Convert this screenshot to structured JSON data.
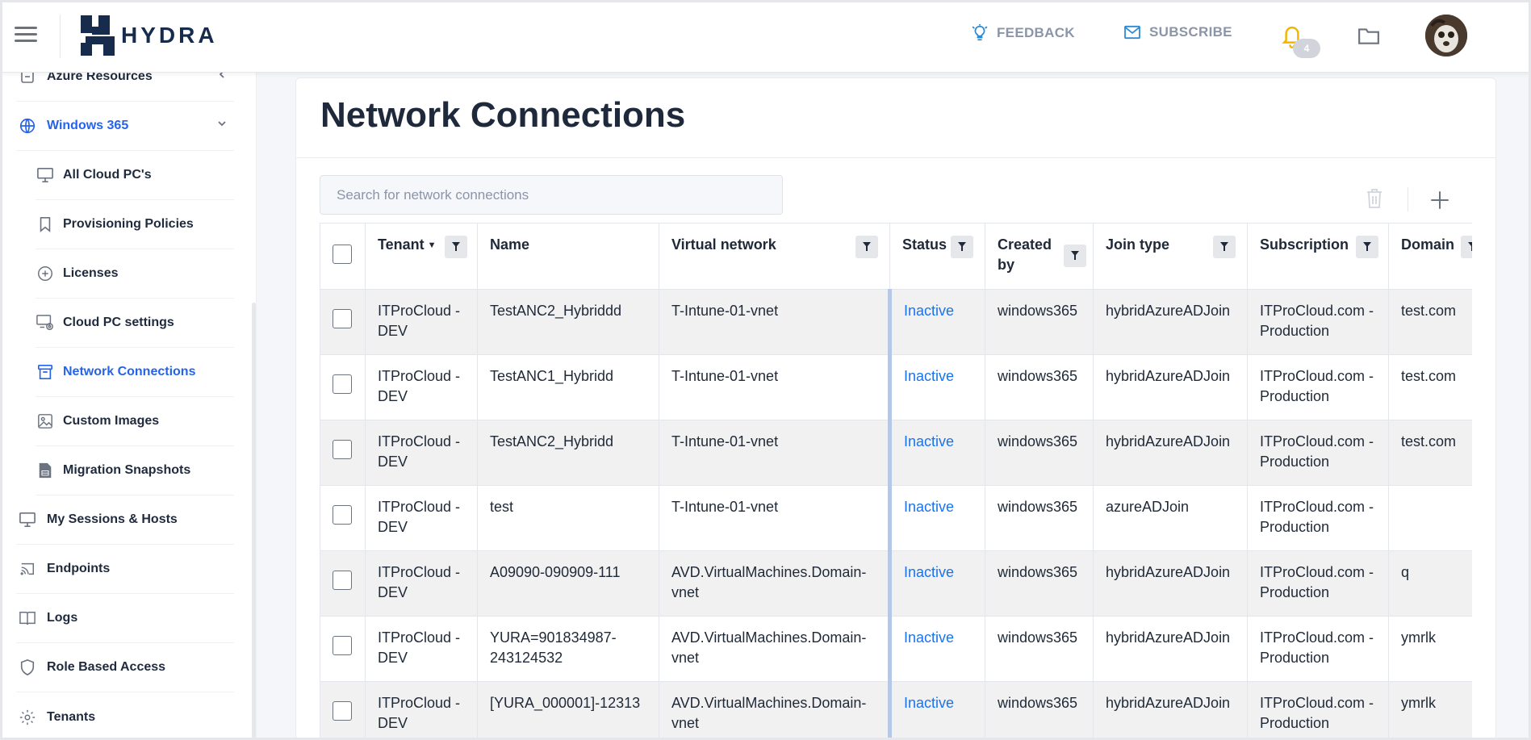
{
  "header": {
    "brand": "HYDRA",
    "feedback_label": "FEEDBACK",
    "subscribe_label": "SUBSCRIBE",
    "notification_count": "4",
    "colors": {
      "brand": "#172b4d",
      "accent": "#2563eb",
      "bell": "#f5b400"
    }
  },
  "sidebar": {
    "items": [
      {
        "label": "Azure Resources",
        "icon": "minus-square-icon"
      },
      {
        "label": "Windows 365",
        "icon": "globe-icon"
      },
      {
        "label": "My Sessions & Hosts",
        "icon": "monitor-icon"
      },
      {
        "label": "Endpoints",
        "icon": "cast-icon"
      },
      {
        "label": "Logs",
        "icon": "book-icon"
      },
      {
        "label": "Role Based Access",
        "icon": "shield-icon"
      },
      {
        "label": "Tenants",
        "icon": "gear-icon"
      }
    ],
    "sub_items": [
      {
        "label": "All Cloud PC's",
        "icon": "monitor-icon"
      },
      {
        "label": "Provisioning Policies",
        "icon": "bookmark-icon"
      },
      {
        "label": "Licenses",
        "icon": "plus-circle-icon"
      },
      {
        "label": "Cloud PC settings",
        "icon": "monitor-gear-icon"
      },
      {
        "label": "Network Connections",
        "icon": "archive-icon"
      },
      {
        "label": "Custom Images",
        "icon": "image-icon"
      },
      {
        "label": "Migration Snapshots",
        "icon": "database-file-icon"
      }
    ]
  },
  "page": {
    "title": "Network Connections",
    "search_placeholder": "Search for network connections"
  },
  "table": {
    "columns": [
      "Tenant",
      "Name",
      "Virtual network",
      "Status",
      "Created by",
      "Join type",
      "Subscription",
      "Domain"
    ],
    "rows": [
      [
        "ITProCloud - DEV",
        "TestANC2_Hybriddd",
        "T-Intune-01-vnet",
        "Inactive",
        "windows365",
        "hybridAzureADJoin",
        "ITProCloud.com - Production",
        "test.com"
      ],
      [
        "ITProCloud - DEV",
        "TestANC1_Hybridd",
        "T-Intune-01-vnet",
        "Inactive",
        "windows365",
        "hybridAzureADJoin",
        "ITProCloud.com - Production",
        "test.com"
      ],
      [
        "ITProCloud - DEV",
        "TestANC2_Hybridd",
        "T-Intune-01-vnet",
        "Inactive",
        "windows365",
        "hybridAzureADJoin",
        "ITProCloud.com - Production",
        "test.com"
      ],
      [
        "ITProCloud - DEV",
        "test",
        "T-Intune-01-vnet",
        "Inactive",
        "windows365",
        "azureADJoin",
        "ITProCloud.com - Production",
        ""
      ],
      [
        "ITProCloud - DEV",
        "A09090-090909-111",
        "AVD.VirtualMachines.Domain-vnet",
        "Inactive",
        "windows365",
        "hybridAzureADJoin",
        "ITProCloud.com - Production",
        "q"
      ],
      [
        "ITProCloud - DEV",
        "YURA=901834987-243124532",
        "AVD.VirtualMachines.Domain-vnet",
        "Inactive",
        "windows365",
        "hybridAzureADJoin",
        "ITProCloud.com - Production",
        "ymrlk"
      ],
      [
        "ITProCloud - DEV",
        "[YURA_000001]-12313",
        "AVD.VirtualMachines.Domain-vnet",
        "Inactive",
        "windows365",
        "hybridAzureADJoin",
        "ITProCloud.com - Production",
        "ymrlk"
      ]
    ]
  }
}
